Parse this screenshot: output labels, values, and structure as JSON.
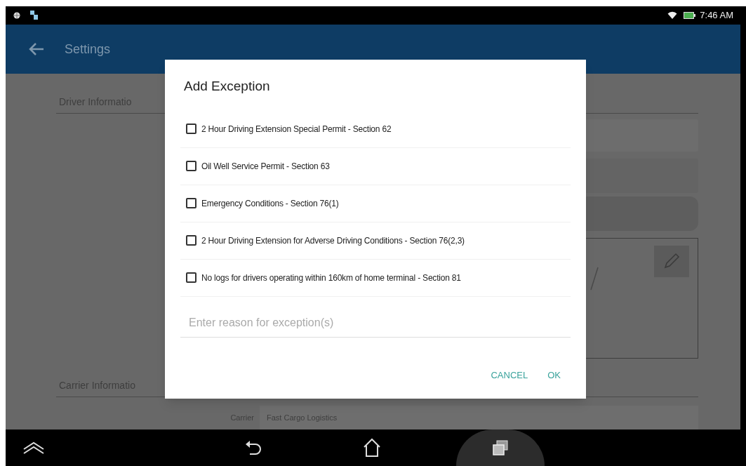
{
  "status_bar": {
    "time": "7:46 AM"
  },
  "app_bar": {
    "title": "Settings"
  },
  "settings": {
    "driver_section": {
      "heading": "Driver Informatio"
    },
    "carrier_section": {
      "heading": "Carrier Informatio",
      "fields": [
        {
          "label": "Carrier",
          "value": "Fast Cargo Logistics"
        }
      ]
    }
  },
  "dialog": {
    "title": "Add Exception",
    "options": [
      {
        "label": "2 Hour Driving Extension Special Permit - Section 62",
        "checked": false
      },
      {
        "label": "Oil Well Service Permit - Section 63",
        "checked": false
      },
      {
        "label": "Emergency Conditions - Section 76(1)",
        "checked": false
      },
      {
        "label": "2 Hour Driving Extension for Adverse Driving Conditions - Section 76(2,3)",
        "checked": false
      },
      {
        "label": "No logs for drivers operating within 160km of home terminal - Section 81",
        "checked": false
      }
    ],
    "reason_field": {
      "placeholder": "Enter reason for exception(s)"
    },
    "buttons": [
      "CANCEL",
      "OK"
    ]
  }
}
